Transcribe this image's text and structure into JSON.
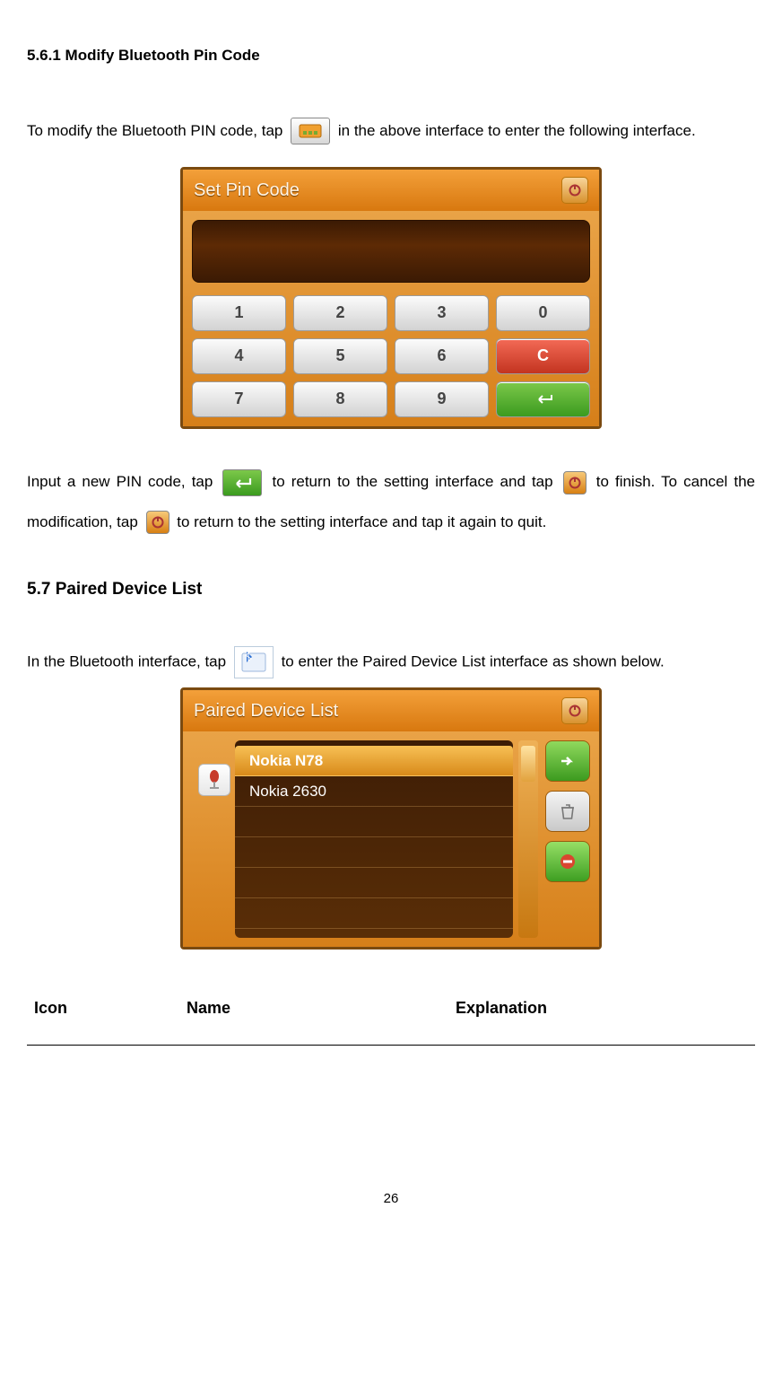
{
  "headings": {
    "s561": "5.6.1 Modify Bluetooth Pin Code",
    "s57": "5.7 Paired Device List"
  },
  "para": {
    "p1a": "To modify the Bluetooth PIN code, tap ",
    "p1b": " in the above interface to enter the following interface.",
    "p2a": "Input a new PIN code, tap ",
    "p2b": " to return to the setting interface and tap ",
    "p2c": " to finish. To cancel the modification, tap ",
    "p2d": " to return to the setting interface and tap it again to quit.",
    "p3a": "In the Bluetooth interface, tap ",
    "p3b": " to enter the Paired Device List interface as shown below."
  },
  "pin_screen": {
    "title": "Set Pin Code",
    "keys": [
      "1",
      "2",
      "3",
      "0",
      "4",
      "5",
      "6",
      "C",
      "7",
      "8",
      "9",
      "↵"
    ]
  },
  "paired_screen": {
    "title": "Paired Device List",
    "devices": [
      "Nokia N78",
      "Nokia 2630",
      "",
      "",
      "",
      ""
    ]
  },
  "table": {
    "col1": "Icon",
    "col2": "Name",
    "col3": "Explanation"
  },
  "page_number": "26"
}
